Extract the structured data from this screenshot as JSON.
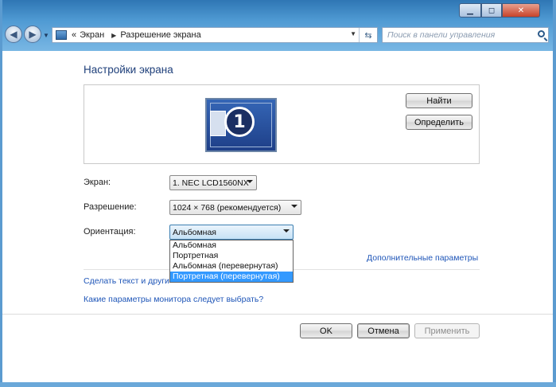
{
  "window": {
    "caption_min": "▁",
    "caption_max": "◻",
    "caption_close": "✕"
  },
  "toolbar": {
    "back_icon": "arrow-left",
    "forward_icon": "arrow-right",
    "breadcrumb_chevron": "«",
    "breadcrumb": [
      "Экран",
      "Разрешение экрана"
    ],
    "breadcrumb_separator": "▶",
    "search_placeholder": "Поиск в панели управления"
  },
  "main": {
    "title": "Настройки экрана",
    "monitor_number": "1",
    "find_button": "Найти",
    "identify_button": "Определить",
    "screen_label": "Экран:",
    "screen_value": "1. NEC LCD1560NX",
    "resolution_label": "Разрешение:",
    "resolution_value": "1024 × 768 (рекомендуется)",
    "orientation_label": "Ориентация:",
    "orientation_value": "Альбомная",
    "orientation_options": [
      "Альбомная",
      "Портретная",
      "Альбомная (перевернутая)",
      "Портретная (перевернутая)"
    ],
    "orientation_highlighted_index": 3,
    "advanced_link": "Дополнительные параметры",
    "text_size_link": "Сделать текст и други",
    "which_settings_link": "Какие параметры монитора следует выбрать?"
  },
  "footer": {
    "ok": "OK",
    "cancel": "Отмена",
    "apply": "Применить"
  },
  "colors": {
    "accent_link": "#1f56b8",
    "title_blue": "#1e3f7a",
    "selection": "#3399ff",
    "frame": "#4f9ad3"
  }
}
